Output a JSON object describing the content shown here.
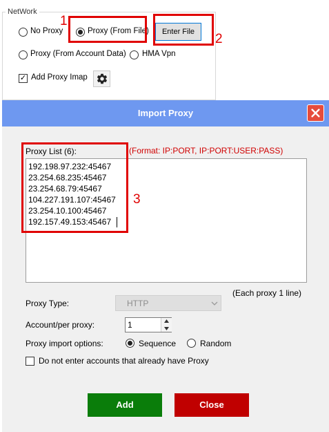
{
  "network": {
    "group_title": "NetWork",
    "options": {
      "no_proxy": "No Proxy",
      "proxy_from_file": "Proxy (From File)",
      "proxy_from_account": "Proxy (From Account Data)",
      "hma_vpn": "HMA Vpn"
    },
    "selected": "proxy_from_file",
    "enter_file_label": "Enter File",
    "add_proxy_imap_label": "Add Proxy Imap",
    "add_proxy_imap_checked": true
  },
  "markers": {
    "one": "1",
    "two": "2",
    "three": "3"
  },
  "dialog": {
    "title": "Import Proxy",
    "list_label": "Proxy List (6):",
    "format_hint": "(Format: IP:PORT, IP:PORT:USER:PASS)",
    "proxies": [
      "192.198.97.232:45467",
      "23.254.68.235:45467",
      "23.254.68.79:45467",
      "104.227.191.107:45467",
      "23.254.10.100:45467",
      "192.157.49.153:45467"
    ],
    "each_line_note": "(Each proxy 1 line)",
    "proxy_type_label": "Proxy Type:",
    "proxy_type_value": "HTTP",
    "account_per_proxy_label": "Account/per proxy:",
    "account_per_proxy_value": "1",
    "import_options_label": "Proxy import options:",
    "option_sequence": "Sequence",
    "option_random": "Random",
    "selected_option": "Sequence",
    "skip_label": "Do not enter accounts that already have Proxy",
    "skip_checked": false,
    "add_label": "Add",
    "close_label": "Close"
  },
  "colors": {
    "titlebar": "#6e98f0",
    "add_button": "#0a7d0a",
    "close_button": "#c00000",
    "annotation": "#e00000",
    "format_hint": "#d00000"
  },
  "icons": [
    "gear-icon",
    "close-icon",
    "chevron-down-icon",
    "spin-up-icon",
    "spin-down-icon",
    "check-icon"
  ]
}
